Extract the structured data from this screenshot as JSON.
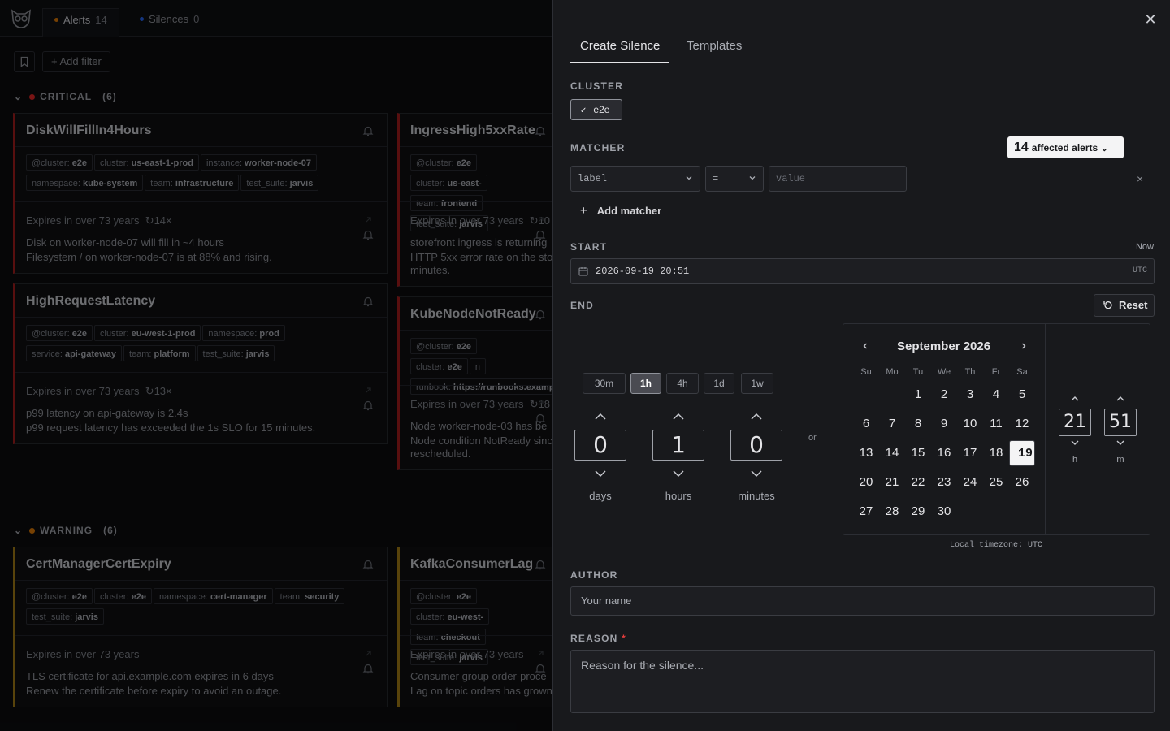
{
  "topbar": {
    "tabs": [
      {
        "label": "Alerts",
        "count": "14",
        "dot_color": "#d97706"
      },
      {
        "label": "Silences",
        "count": "0",
        "dot_color": "#2563eb"
      }
    ],
    "add_filter_label": "+ Add filter"
  },
  "groups": [
    {
      "label": "CRITICAL",
      "count": "(6)",
      "dot_color": "#dc2626"
    },
    {
      "label": "WARNING",
      "count": "(6)",
      "dot_color": "#d97706"
    }
  ],
  "cards": [
    {
      "title": "DiskWillFillIn4Hours",
      "chips": [
        {
          "k": "@cluster:",
          "v": "e2e"
        },
        {
          "k": "cluster:",
          "v": "us-east-1-prod"
        },
        {
          "k": "instance:",
          "v": "worker-node-07"
        },
        {
          "k": "namespace:",
          "v": "kube-system"
        },
        {
          "k": "team:",
          "v": "infrastructure"
        },
        {
          "k": "test_suite:",
          "v": "jarvis"
        }
      ],
      "expires": "Expires in over 73 years",
      "repeat": "↻14×",
      "desc1": "Disk on worker-node-07 will fill in ~4 hours",
      "desc2": "Filesystem / on worker-node-07 is at 88% and rising."
    },
    {
      "title": "HighRequestLatency",
      "chips": [
        {
          "k": "@cluster:",
          "v": "e2e"
        },
        {
          "k": "cluster:",
          "v": "eu-west-1-prod"
        },
        {
          "k": "namespace:",
          "v": "prod"
        },
        {
          "k": "service:",
          "v": "api-gateway"
        },
        {
          "k": "team:",
          "v": "platform"
        },
        {
          "k": "test_suite:",
          "v": "jarvis"
        }
      ],
      "expires": "Expires in over 73 years",
      "repeat": "↻13×",
      "desc1": "p99 latency on api-gateway is 2.4s",
      "desc2": "p99 request latency has exceeded the 1s SLO for 15 minutes."
    },
    {
      "title": "IngressHigh5xxRate",
      "chips": [
        {
          "k": "@cluster:",
          "v": "e2e"
        },
        {
          "k": "cluster:",
          "v": "us-east-"
        },
        {
          "k": "team:",
          "v": "frontend"
        },
        {
          "k": "test_suite:",
          "v": "jarvis"
        }
      ],
      "expires": "Expires in over 73 years",
      "repeat": "↻10",
      "desc1": "storefront ingress is returning",
      "desc2": "HTTP 5xx error rate on the sto",
      "desc3": "minutes."
    },
    {
      "title": "KubeNodeNotReady",
      "chips": [
        {
          "k": "@cluster:",
          "v": "e2e"
        },
        {
          "k": "cluster:",
          "v": "e2e"
        },
        {
          "k": "n",
          "v": ""
        },
        {
          "k": "runbook:",
          "v": "https://runbooks.example"
        }
      ],
      "expires": "Expires in over 73 years",
      "repeat": "↻18",
      "desc1": "Node worker-node-03 has be",
      "desc2": "Node condition NotReady sinc",
      "desc3": "rescheduled."
    },
    {
      "title": "CertManagerCertExpiry",
      "chips": [
        {
          "k": "@cluster:",
          "v": "e2e"
        },
        {
          "k": "cluster:",
          "v": "e2e"
        },
        {
          "k": "namespace:",
          "v": "cert-manager"
        },
        {
          "k": "team:",
          "v": "security"
        },
        {
          "k": "test_suite:",
          "v": "jarvis"
        }
      ],
      "expires": "Expires in over 73 years",
      "desc1": "TLS certificate for api.example.com expires in 6 days",
      "desc2": "Renew the certificate before expiry to avoid an outage."
    },
    {
      "title": "KafkaConsumerLag",
      "chips": [
        {
          "k": "@cluster:",
          "v": "e2e"
        },
        {
          "k": "cluster:",
          "v": "eu-west-"
        },
        {
          "k": "team:",
          "v": "checkout"
        },
        {
          "k": "test_suite:",
          "v": "jarvis"
        }
      ],
      "expires": "Expires in over 73 years",
      "desc1": "Consumer group order-proce",
      "desc2": "Lag on topic orders has grown"
    }
  ],
  "panel": {
    "tabs": [
      "Create Silence",
      "Templates"
    ],
    "cluster_label": "CLUSTER",
    "cluster_value": "e2e",
    "matcher_label": "MATCHER",
    "affected_count": "14",
    "affected_label": "affected alerts",
    "matcher_label_select": "label",
    "matcher_op": "=",
    "matcher_value_placeholder": "value",
    "add_matcher": "Add matcher",
    "start_label": "START",
    "now_label": "Now",
    "start_value": "2026-09-19 20:51",
    "start_tz": "UTC",
    "end_label": "END",
    "reset_label": "Reset",
    "quick": [
      "30m",
      "1h",
      "4h",
      "1d",
      "1w"
    ],
    "quick_active": "1h",
    "duration": {
      "days": "0",
      "hours": "1",
      "minutes": "0"
    },
    "duration_units": {
      "days": "days",
      "hours": "hours",
      "minutes": "minutes"
    },
    "or": "or",
    "calendar": {
      "month": "September 2026",
      "dow": [
        "Su",
        "Mo",
        "Tu",
        "We",
        "Th",
        "Fr",
        "Sa"
      ],
      "first_weekday": 2,
      "days_in_month": 30,
      "selected": 19
    },
    "time": {
      "h": "21",
      "m": "51",
      "h_label": "h",
      "m_label": "m"
    },
    "timezone_note": "Local timezone: UTC",
    "author_label": "AUTHOR",
    "author_placeholder": "Your name",
    "reason_label": "REASON",
    "reason_required": "*",
    "reason_placeholder": "Reason for the silence..."
  }
}
